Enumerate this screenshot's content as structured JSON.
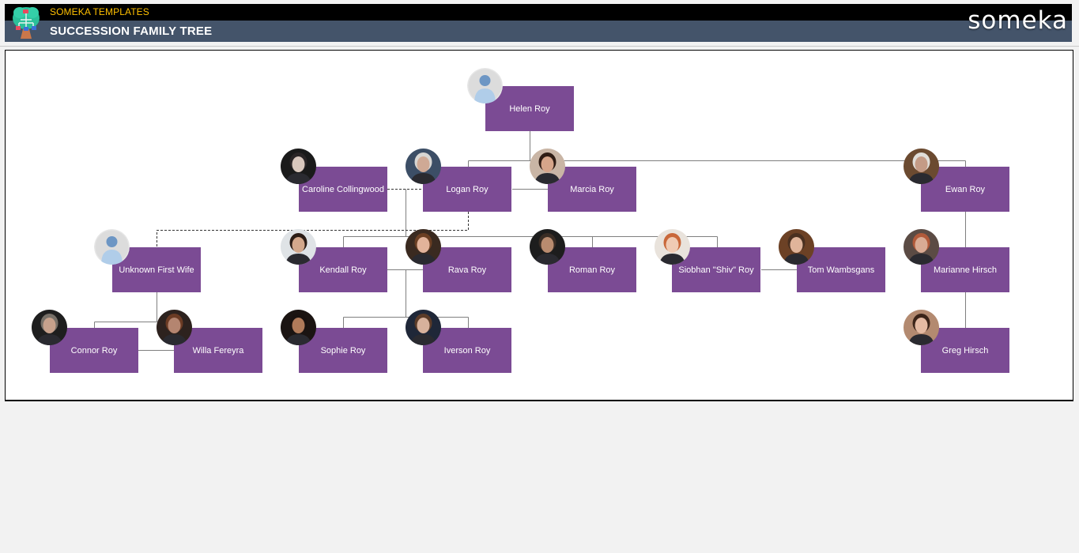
{
  "header": {
    "brand_sub": "SOMEKA TEMPLATES",
    "title": "SUCCESSION FAMILY TREE",
    "wordmark": "someka",
    "logo_icon": "family-tree-icon",
    "colors": {
      "top_bar": "#000000",
      "title_bar": "#44546a",
      "brand_sub": "#ffc000"
    }
  },
  "tree": {
    "node_color": "#7b4b94",
    "members": [
      {
        "id": "helen",
        "name": "Helen Roy",
        "photo": "placeholder",
        "skin": "#b0cde9",
        "bg": "#e6e6e6",
        "hair": "#6d96c4"
      },
      {
        "id": "caroline",
        "name": "Caroline Collingwood",
        "photo": "portrait",
        "skin": "#d9c7bd",
        "bg": "#1a1a1a",
        "hair": "#2a2526"
      },
      {
        "id": "logan",
        "name": "Logan Roy",
        "photo": "portrait",
        "skin": "#cfa995",
        "bg": "#3c4e66",
        "hair": "#d8d6d3"
      },
      {
        "id": "marcia",
        "name": "Marcia Roy",
        "photo": "portrait",
        "skin": "#d6a58a",
        "bg": "#c9b5a5",
        "hair": "#2f1c14"
      },
      {
        "id": "ewan",
        "name": "Ewan Roy",
        "photo": "portrait",
        "skin": "#c49b86",
        "bg": "#6b4a30",
        "hair": "#e0ddd8"
      },
      {
        "id": "unknown",
        "name": "Unknown First Wife",
        "photo": "placeholder",
        "skin": "#b0cde9",
        "bg": "#e6e6e6",
        "hair": "#6d96c4"
      },
      {
        "id": "kendall",
        "name": "Kendall Roy",
        "photo": "portrait",
        "skin": "#d3a88c",
        "bg": "#dfe3e6",
        "hair": "#2b1d16"
      },
      {
        "id": "rava",
        "name": "Rava Roy",
        "photo": "portrait",
        "skin": "#e2b39a",
        "bg": "#3a2a20",
        "hair": "#6b3f23"
      },
      {
        "id": "roman",
        "name": "Roman Roy",
        "photo": "portrait",
        "skin": "#b98b6f",
        "bg": "#1d1d1d",
        "hair": "#3a2d25"
      },
      {
        "id": "shiv",
        "name": "Siobhan \"Shiv\" Roy",
        "photo": "portrait",
        "skin": "#f0cbb4",
        "bg": "#e9e3dc",
        "hair": "#c9683a"
      },
      {
        "id": "tom",
        "name": "Tom Wambsgans",
        "photo": "portrait",
        "skin": "#e0b49a",
        "bg": "#6c4125",
        "hair": "#4a3020"
      },
      {
        "id": "marianne",
        "name": "Marianne Hirsch",
        "photo": "portrait",
        "skin": "#d9ab94",
        "bg": "#5b4b44",
        "hair": "#b15a3a"
      },
      {
        "id": "connor",
        "name": "Connor Roy",
        "photo": "portrait",
        "skin": "#c7a18c",
        "bg": "#1e1e1e",
        "hair": "#777068"
      },
      {
        "id": "willa",
        "name": "Willa Fereyra",
        "photo": "portrait",
        "skin": "#b48570",
        "bg": "#2d221e",
        "hair": "#6b3b24"
      },
      {
        "id": "sophie",
        "name": "Sophie Roy",
        "photo": "portrait",
        "skin": "#b07a5a",
        "bg": "#1b1412",
        "hair": "#1a1210"
      },
      {
        "id": "iverson",
        "name": "Iverson Roy",
        "photo": "portrait",
        "skin": "#d7b19c",
        "bg": "#1f2738",
        "hair": "#5b3b28"
      },
      {
        "id": "greg",
        "name": "Greg Hirsch",
        "photo": "portrait",
        "skin": "#e5bba3",
        "bg": "#b38a70",
        "hair": "#3b2418"
      }
    ]
  }
}
